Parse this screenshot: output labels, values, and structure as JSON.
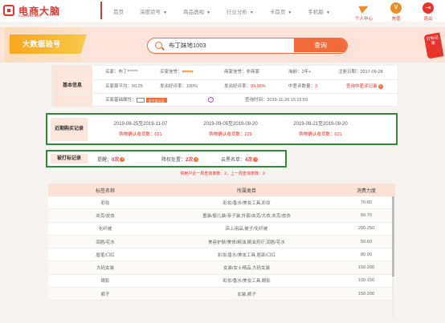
{
  "brand": {
    "name": "电商大脑",
    "sub": "Ecommerce Brain"
  },
  "nav": {
    "items": [
      {
        "label": "首页",
        "has_caret": false
      },
      {
        "label": "深度验号",
        "has_caret": true
      },
      {
        "label": "商品透视",
        "has_caret": true
      },
      {
        "label": "行业分析",
        "has_caret": true
      },
      {
        "label": "卡首页",
        "has_caret": true
      },
      {
        "label": "手机版",
        "has_caret": true
      }
    ],
    "right": [
      {
        "label": "个人中心",
        "icon": "paper-plane-icon"
      },
      {
        "label": "充值",
        "icon": "vip-icon"
      },
      {
        "label": "退出",
        "icon": "exit-icon"
      }
    ]
  },
  "search": {
    "badge": "大数据验号",
    "value": "布丁妹地1003",
    "button": "查询",
    "side_tag": "打标记录"
  },
  "basic": {
    "label": "基本信息",
    "row1": {
      "buyer": "买家：布丁******",
      "buyer_credit_label": "买家信誉：",
      "buyer_credit_hearts": "♥♥♥♥♥",
      "seller_credit": "商家信誉：非商家",
      "age": "淘龄：2年+",
      "reg": "注册日期：2017-09-28"
    },
    "row2": {
      "week_avg": "买家周平均：60.25",
      "send_rate": "发出好评率：100%",
      "recv_rate_label": "发出好评率：",
      "recv_rate": "99.96%",
      "bad_label": "中差评数量：",
      "bad": "3",
      "link": "查询中差评记录"
    },
    "row3": {
      "verify_label": "买家基础属性：",
      "tag": "支付宝认证",
      "query_time": "查询时间：2019-11-20 15:15:59"
    }
  },
  "recent": {
    "label": "近期购买记录",
    "cols": [
      {
        "dates": "2019-08-25至2019-11-07",
        "count": "购物确认收货数：651"
      },
      {
        "dates": "2019-09-05至2019-09-20",
        "count": "购物确认收货数：229"
      },
      {
        "dates": "2019-08-21至2019-09-20",
        "count": "购物确认收货数：631"
      }
    ]
  },
  "report": {
    "label": "被打标记录",
    "items": [
      {
        "label": "提醒：",
        "value": "0次"
      },
      {
        "label": "降权处置：",
        "value": "2次"
      },
      {
        "label": "云黑名单：",
        "value": "4次"
      }
    ]
  },
  "note": "供用户近一周查询率数：2，上一周查询率数：2",
  "table": {
    "headers": [
      "标签名称",
      "所属类目",
      "消费力度"
    ],
    "rows": [
      [
        "彩妆",
        "彩妆/香水/美妆工具,彩妆",
        "70-80"
      ],
      [
        "夹克/皮衣",
        "童装/婴儿装/亲子装,外套/夹克/大衣,夹克/皮衣",
        "60-70"
      ],
      [
        "化纤被",
        "床上用品,被子/化纤被",
        "200-250"
      ],
      [
        "润唇/花水",
        "美容护肤/美体/精油,精油芳疗,润唇/花水",
        "50-60"
      ],
      [
        "眉笔/口红",
        "彩妆/香水/美妆工具,唇部/口红",
        "80-90"
      ],
      [
        "大码女装",
        "女装/女士精品,大码女装",
        "150-200"
      ],
      [
        "眼影",
        "彩妆/香水/美妆工具,眼影",
        "100-150"
      ],
      [
        "裤子",
        "女装,裤子",
        "150-200"
      ]
    ]
  }
}
